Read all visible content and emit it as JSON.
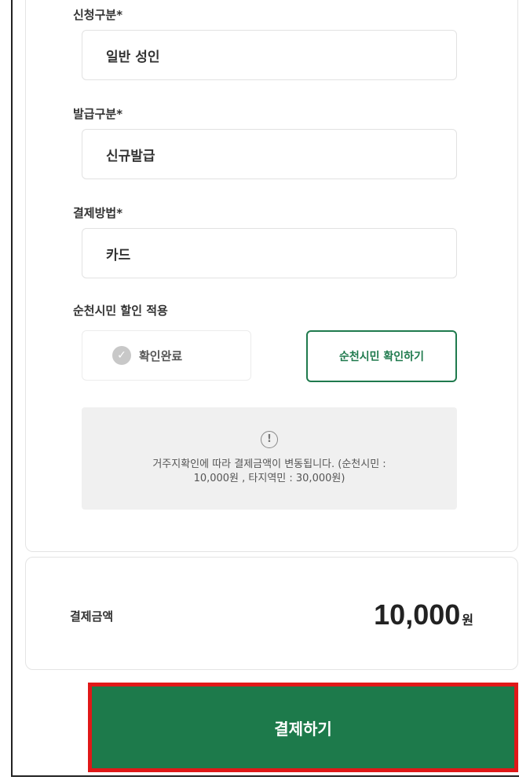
{
  "form": {
    "application_type": {
      "label": "신청구분*",
      "value": "일반 성인"
    },
    "issue_type": {
      "label": "발급구분*",
      "value": "신규발급"
    },
    "payment_method": {
      "label": "결제방법*",
      "value": "카드"
    },
    "discount": {
      "label": "순천시민 할인 적용",
      "status_text": "확인완료",
      "status_icon": "check-icon",
      "verify_button": "순천시민 확인하기"
    },
    "notice": {
      "icon": "info-icon",
      "line1": "거주지확인에 따라 결제금액이 변동됩니다. (순천시민 :",
      "line2": "10,000원 , 타지역민 : 30,000원)"
    }
  },
  "summary": {
    "label": "결제금액",
    "amount": "10,000",
    "unit": "원"
  },
  "pay_button": {
    "label": "결제하기"
  },
  "colors": {
    "accent_green": "#1d7a4b",
    "highlight_red": "#e01818",
    "notice_bg": "#f0f0f0"
  }
}
